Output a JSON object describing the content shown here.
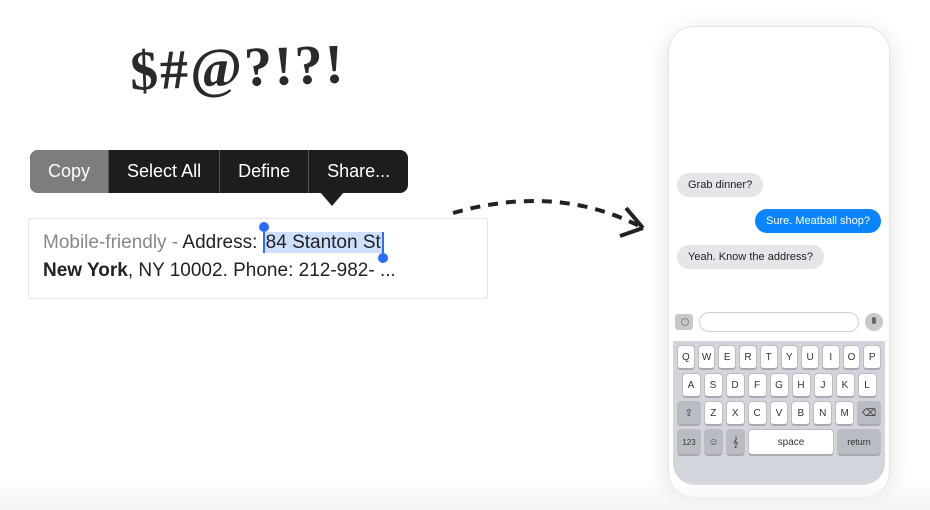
{
  "graffiti": "$#@?!?!",
  "menu": {
    "copy": "Copy",
    "select_all": "Select All",
    "define": "Define",
    "share": "Share..."
  },
  "snippet": {
    "prefix_gray": "Mobile-friendly - ",
    "address_label": "Address: ",
    "selected": "84 Stanton St",
    "line2_bold": "New York",
    "line2_rest": ", NY 10002. Phone: 212-982- ..."
  },
  "chat": {
    "m1": "Grab dinner?",
    "m2": "Sure. Meatball shop?",
    "m3": "Yeah. Know the address?"
  },
  "keyboard": {
    "row1": [
      "Q",
      "W",
      "E",
      "R",
      "T",
      "Y",
      "U",
      "I",
      "O",
      "P"
    ],
    "row2": [
      "A",
      "S",
      "D",
      "F",
      "G",
      "H",
      "J",
      "K",
      "L"
    ],
    "row3": [
      "Z",
      "X",
      "C",
      "V",
      "B",
      "N",
      "M"
    ],
    "shift": "⇧",
    "backspace": "⌫",
    "num": "123",
    "globe": "🌐",
    "mic": "🎤",
    "space": "space",
    "return": "return"
  }
}
